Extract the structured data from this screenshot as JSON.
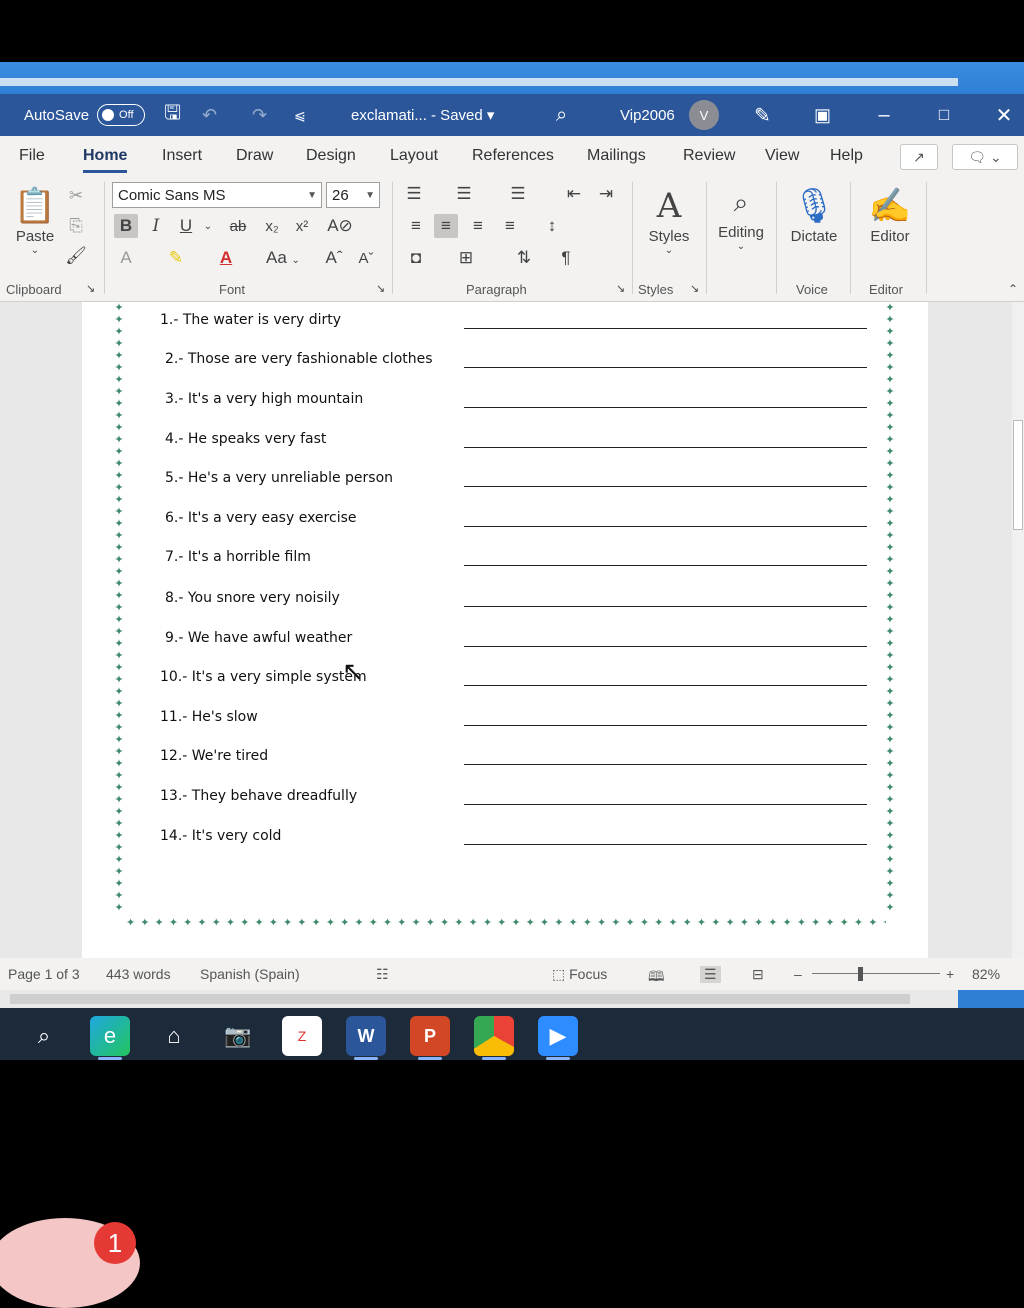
{
  "titlebar": {
    "autosave_label": "AutoSave",
    "autosave_state": "Off",
    "doc_title": "exclamati... - Saved ▾",
    "user_name": "Vip2006",
    "user_initial": "V"
  },
  "menu": {
    "tabs": [
      "File",
      "Home",
      "Insert",
      "Draw",
      "Design",
      "Layout",
      "References",
      "Mailings",
      "Review",
      "View",
      "Help"
    ],
    "active": "Home"
  },
  "ribbon": {
    "font_name": "Comic Sans MS",
    "font_size": "26",
    "paste_label": "Paste",
    "styles_label": "Styles",
    "editing_label": "Editing",
    "dictate_label": "Dictate",
    "editor_label": "Editor",
    "groups": {
      "clipboard": "Clipboard",
      "font": "Font",
      "paragraph": "Paragraph",
      "styles": "Styles",
      "voice": "Voice",
      "editor": "Editor"
    },
    "case_label": "Aa"
  },
  "document": {
    "sentences": [
      "1.- The water is very dirty",
      "2.- Those are very fashionable clothes",
      "3.- It's a very high mountain",
      "4.- He speaks very fast",
      "5.- He's a very unreliable person",
      "6.- It's a very easy exercise",
      "7.- It's a horrible film",
      "8.- You snore very noisily",
      "9.- We have awful weather",
      "10.- It's a very simple system",
      "11.- He's slow",
      "12.- We're tired",
      "13.- They behave dreadfully",
      "14.- It's very cold"
    ]
  },
  "status": {
    "page": "Page 1 of 3",
    "words": "443 words",
    "language": "Spanish (Spain)",
    "focus": "Focus",
    "zoom": "82%"
  },
  "notification": {
    "count": "1"
  }
}
